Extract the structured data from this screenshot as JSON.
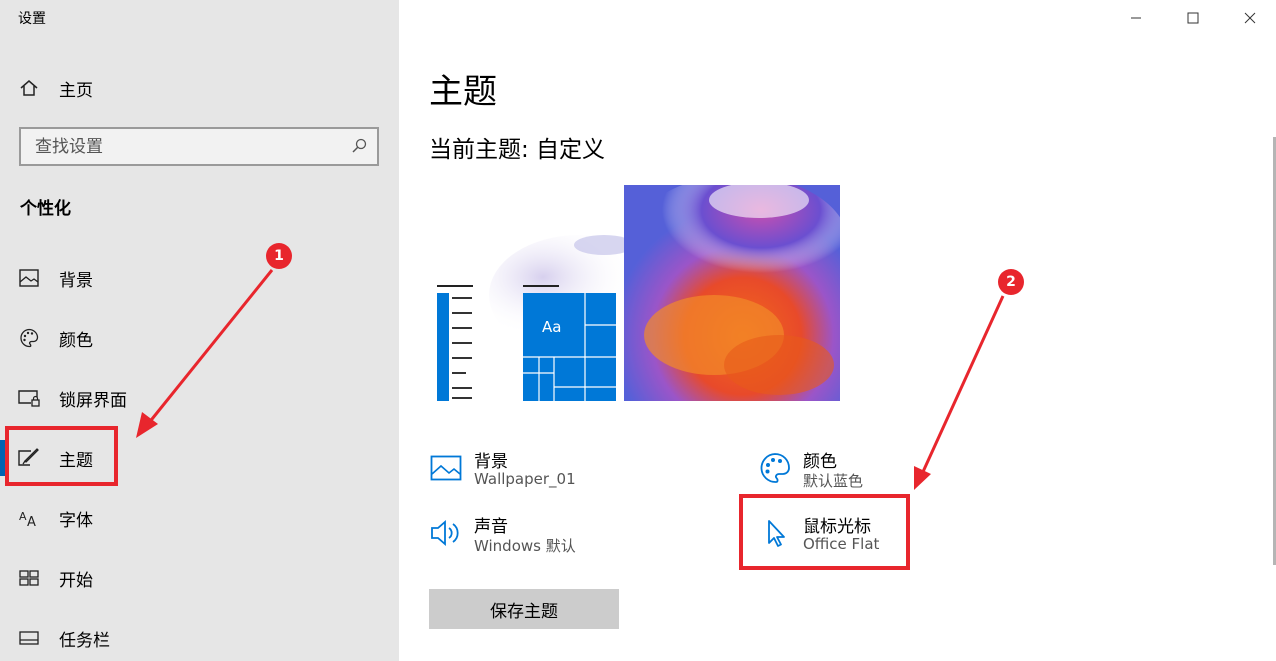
{
  "window": {
    "title": "设置",
    "controls": {
      "minimize": "—",
      "maximize": "☐",
      "close": "✕"
    }
  },
  "sidebar": {
    "home_label": "主页",
    "search_placeholder": "查找设置",
    "section_title": "个性化",
    "items": [
      {
        "label": "背景",
        "icon": "image-icon"
      },
      {
        "label": "颜色",
        "icon": "palette-icon"
      },
      {
        "label": "锁屏界面",
        "icon": "lock-screen-icon"
      },
      {
        "label": "主题",
        "icon": "theme-brush-icon",
        "active": true
      },
      {
        "label": "字体",
        "icon": "font-icon"
      },
      {
        "label": "开始",
        "icon": "start-icon"
      },
      {
        "label": "任务栏",
        "icon": "taskbar-icon"
      }
    ]
  },
  "annotations": {
    "badge1": "1",
    "badge2": "2"
  },
  "main": {
    "title": "主题",
    "current_theme": "当前主题: 自定义",
    "preview": {
      "tile_text": "Aa"
    },
    "properties": {
      "background": {
        "name": "背景",
        "value": "Wallpaper_01"
      },
      "color": {
        "name": "颜色",
        "value": "默认蓝色"
      },
      "sound": {
        "name": "声音",
        "value": "Windows 默认"
      },
      "cursor": {
        "name": "鼠标光标",
        "value": "Office Flat"
      }
    },
    "save_button": "保存主题"
  },
  "colors": {
    "accent": "#0078d7",
    "highlight_red": "#e8262d",
    "sidebar_bg": "#e6e6e6"
  }
}
